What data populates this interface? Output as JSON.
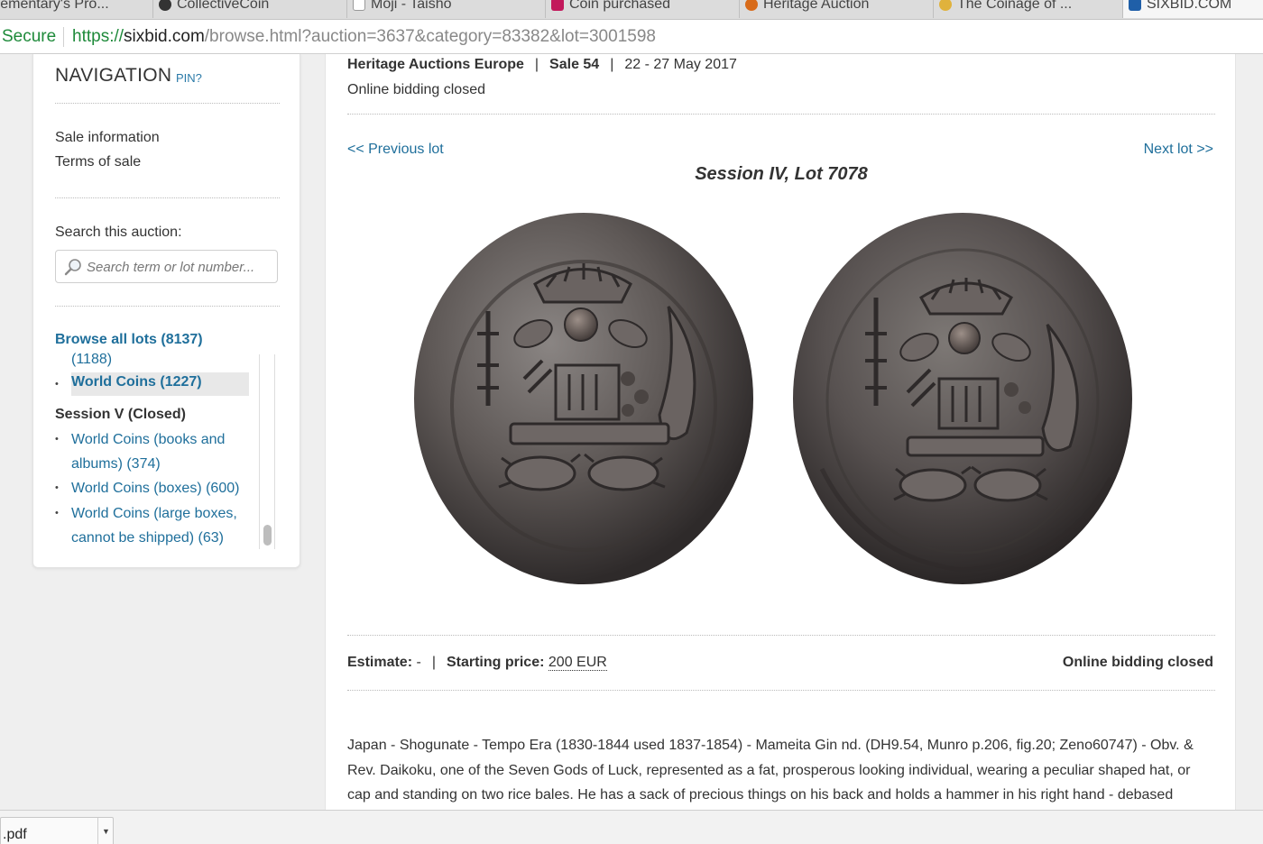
{
  "browser": {
    "tabs": [
      {
        "label": "Elementary's Pro...",
        "color": "#555555"
      },
      {
        "label": "CollectiveCoin",
        "color": "#333333"
      },
      {
        "label": "Moji - Taisho",
        "color": "#999999"
      },
      {
        "label": "Coin purchased",
        "color": "#c2185b"
      },
      {
        "label": "Heritage Auction",
        "color": "#d86b1a"
      },
      {
        "label": "The Coinage of ...",
        "color": "#e0b23c"
      },
      {
        "label": "SIXBID.COM",
        "color": "#1f5fa8"
      }
    ],
    "secure_label": "Secure",
    "url_scheme": "https://",
    "url_host": "sixbid.com",
    "url_path": "/browse.html?auction=3637&category=83382&lot=3001598"
  },
  "sidebar": {
    "title": "NAVIGATION",
    "pin_label": "PIN?",
    "links": [
      "Sale information",
      "Terms of sale"
    ],
    "search_label": "Search this auction:",
    "search_placeholder": "Search term or lot number...",
    "browse_all": "Browse all lots (8137)",
    "partial_count": "(1188)",
    "active_category": "World Coins (1227)",
    "session_heading": "Session V (Closed)",
    "session_items": [
      {
        "line1": "World Coins (books and",
        "line2": "albums) (374)"
      },
      {
        "line1": "World Coins (boxes) (600)",
        "line2": ""
      },
      {
        "line1": "World Coins (large boxes,",
        "line2": "cannot be shipped) (63)"
      }
    ]
  },
  "header": {
    "auction_house": "Heritage Auctions Europe",
    "sale": "Sale 54",
    "dates": "22 - 27 May 2017",
    "status": "Online bidding closed"
  },
  "lot": {
    "prev_label": "<< Previous lot",
    "next_label": "Next lot >>",
    "title": "Session IV, Lot 7078",
    "estimate_label": "Estimate:",
    "estimate_value": "-",
    "starting_label": "Starting price:",
    "starting_value": "200 EUR",
    "bidding_status": "Online bidding closed",
    "description": "Japan - Shogunate - Tempo Era (1830-1844 used 1837-1854) - Mameita Gin nd. (DH9.54, Munro p.206, fig.20; Zeno60747) - Obv. & Rev. Daikoku, one of the Seven Gods of Luck, represented as a fat, prosperous looking individual, wearing a peculiar shaped hat, or cap and standing on two rice bales. He has a sack of precious things on his back and holds a hammer in his right hand - debased"
  },
  "downloads": {
    "file_label": ".pdf"
  }
}
